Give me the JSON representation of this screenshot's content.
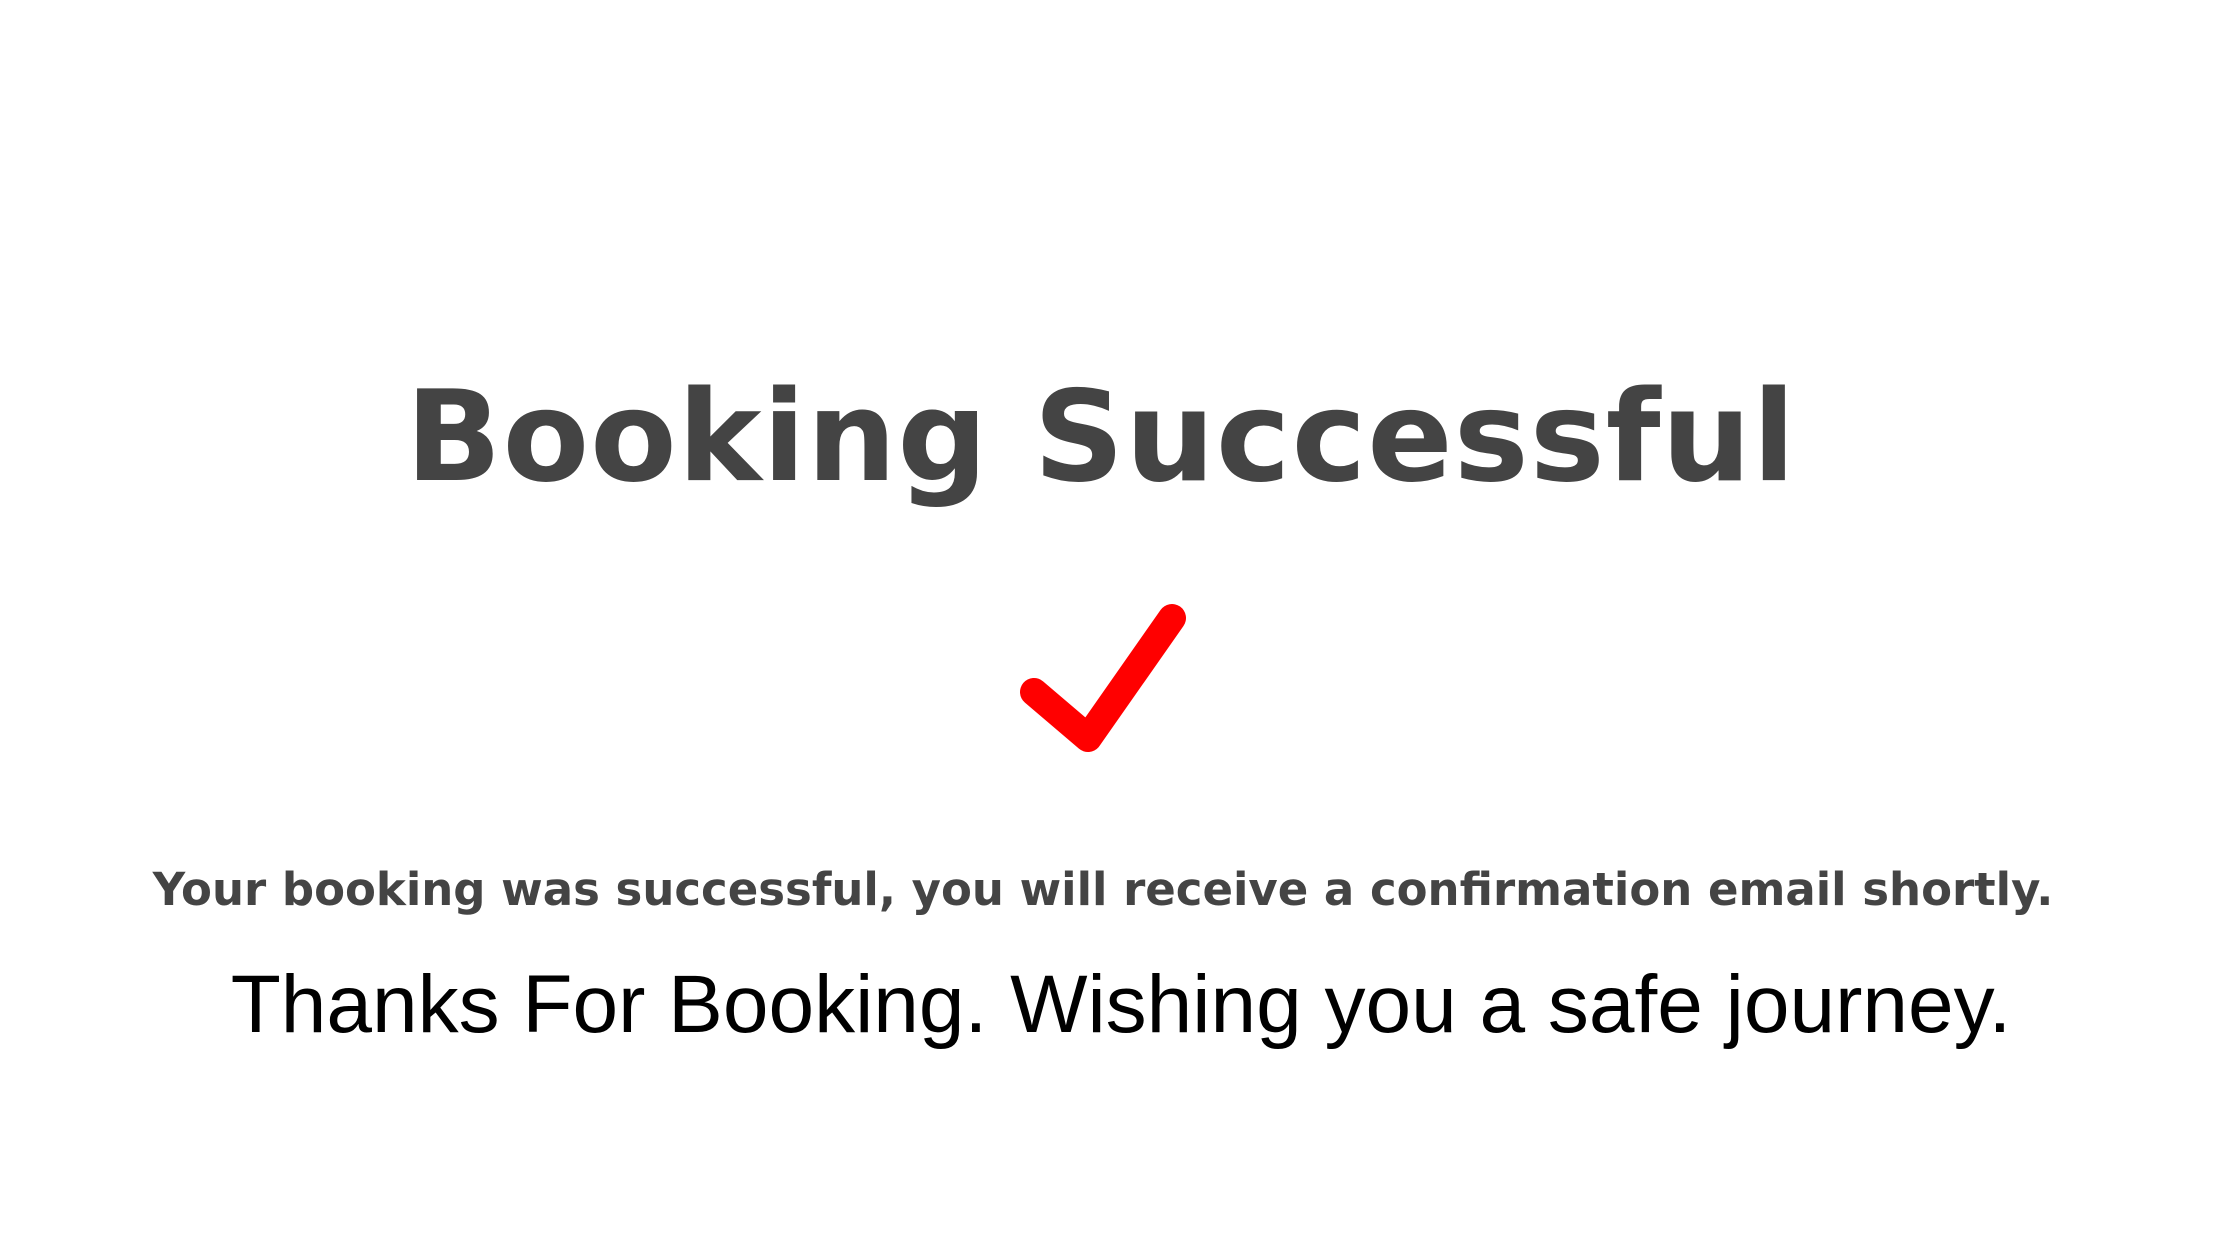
{
  "page": {
    "title": "Booking Successful",
    "message": "Your booking was successful, you will receive a confirmation email shortly.",
    "thanks": "Thanks For Booking. Wishing you a safe journey."
  },
  "icons": {
    "status": "checkmark-icon"
  },
  "colors": {
    "background": "#ffffff",
    "title_text": "#444444",
    "message_text": "#444444",
    "thanks_text": "#000000",
    "check": "#ff0000"
  }
}
